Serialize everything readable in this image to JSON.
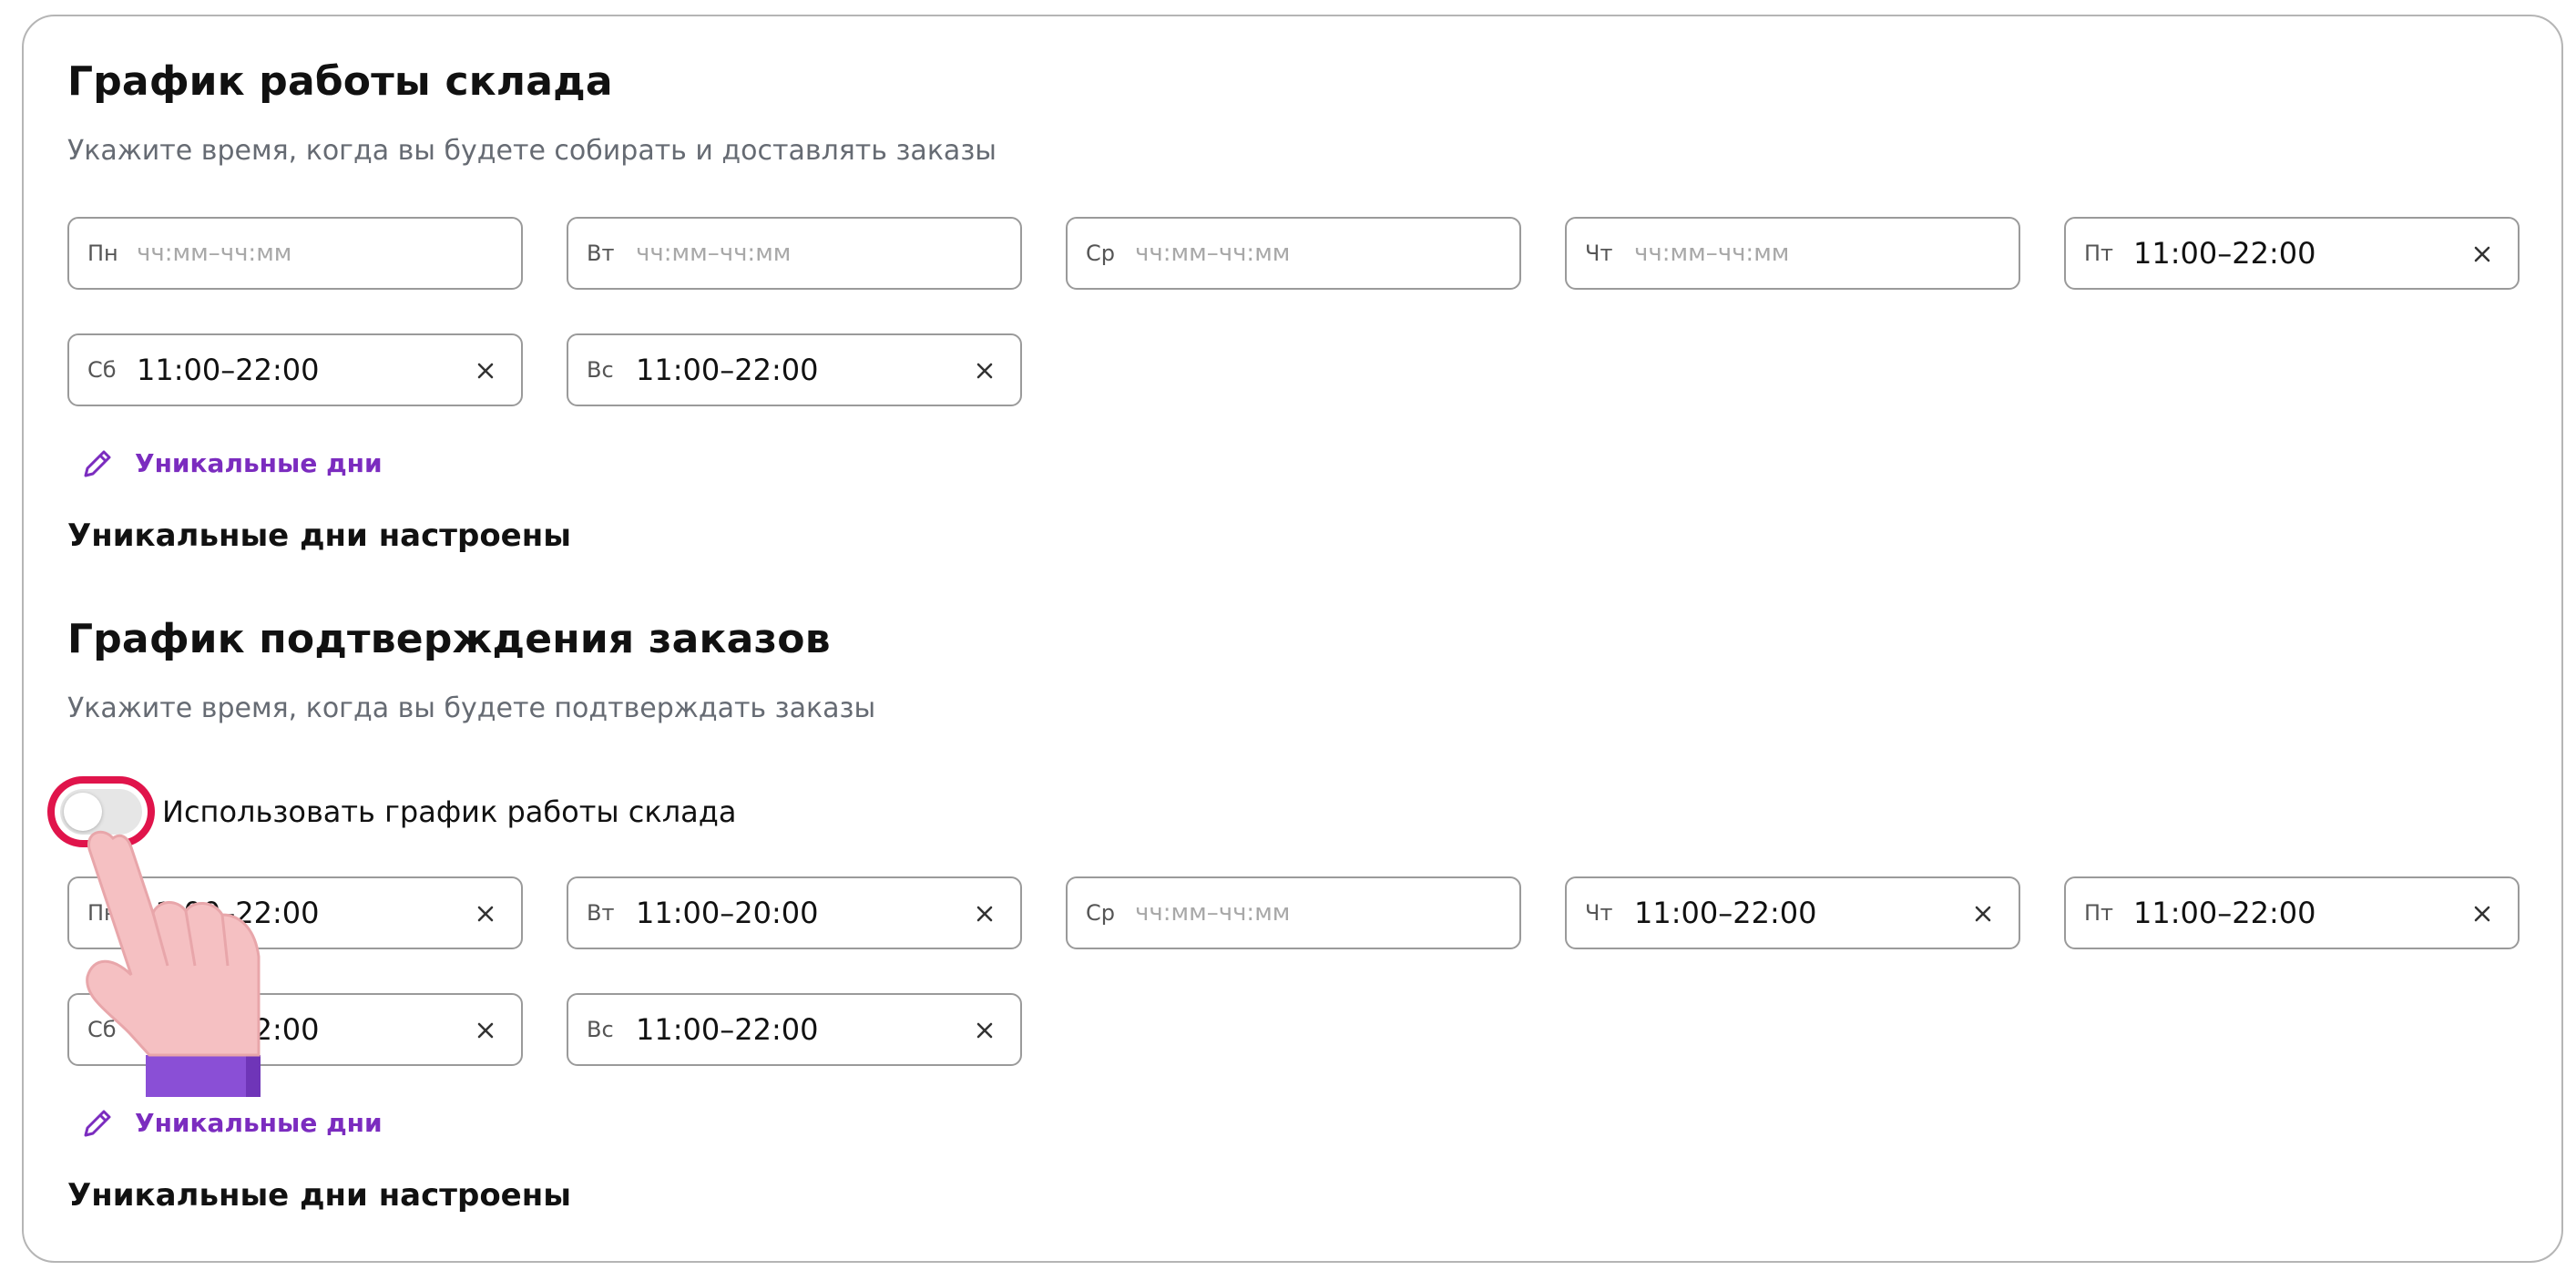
{
  "warehouse_schedule": {
    "title": "График работы склада",
    "subtitle": "Укажите время, когда вы будете собирать и доставлять заказы",
    "days": [
      {
        "label": "Пн",
        "value": "",
        "placeholder": "чч:мм–чч:мм"
      },
      {
        "label": "Вт",
        "value": "",
        "placeholder": "чч:мм–чч:мм"
      },
      {
        "label": "Ср",
        "value": "",
        "placeholder": "чч:мм–чч:мм"
      },
      {
        "label": "Чт",
        "value": "",
        "placeholder": "чч:мм–чч:мм"
      },
      {
        "label": "Пт",
        "value": "11:00–22:00",
        "placeholder": ""
      },
      {
        "label": "Сб",
        "value": "11:00–22:00",
        "placeholder": ""
      },
      {
        "label": "Вс",
        "value": "11:00–22:00",
        "placeholder": ""
      }
    ],
    "unique_days_link": "Уникальные дни",
    "unique_days_status": "Уникальные дни настроены"
  },
  "confirmation_schedule": {
    "title": "График подтверждения заказов",
    "subtitle": "Укажите время, когда вы будете подтверждать заказы",
    "toggle": {
      "label": "Использовать график работы склада",
      "checked": false
    },
    "days": [
      {
        "label": "Пн",
        "value": "11:00–22:00",
        "placeholder": ""
      },
      {
        "label": "Вт",
        "value": "11:00–20:00",
        "placeholder": ""
      },
      {
        "label": "Ср",
        "value": "",
        "placeholder": "чч:мм–чч:мм"
      },
      {
        "label": "Чт",
        "value": "11:00–22:00",
        "placeholder": ""
      },
      {
        "label": "Пт",
        "value": "11:00–22:00",
        "placeholder": ""
      },
      {
        "label": "Сб",
        "value": "11:00–22:00",
        "placeholder": ""
      },
      {
        "label": "Вс",
        "value": "11:00–22:00",
        "placeholder": ""
      }
    ],
    "unique_days_link": "Уникальные дни",
    "unique_days_status": "Уникальные дни настроены"
  },
  "colors": {
    "accent": "#7b2cbf",
    "highlight": "#e0144b",
    "border": "#9a9a9a",
    "placeholder": "#a8a8a8"
  },
  "icons": {
    "edit": "pencil-icon",
    "clear": "close-icon",
    "pointer": "pointing-hand-icon"
  }
}
